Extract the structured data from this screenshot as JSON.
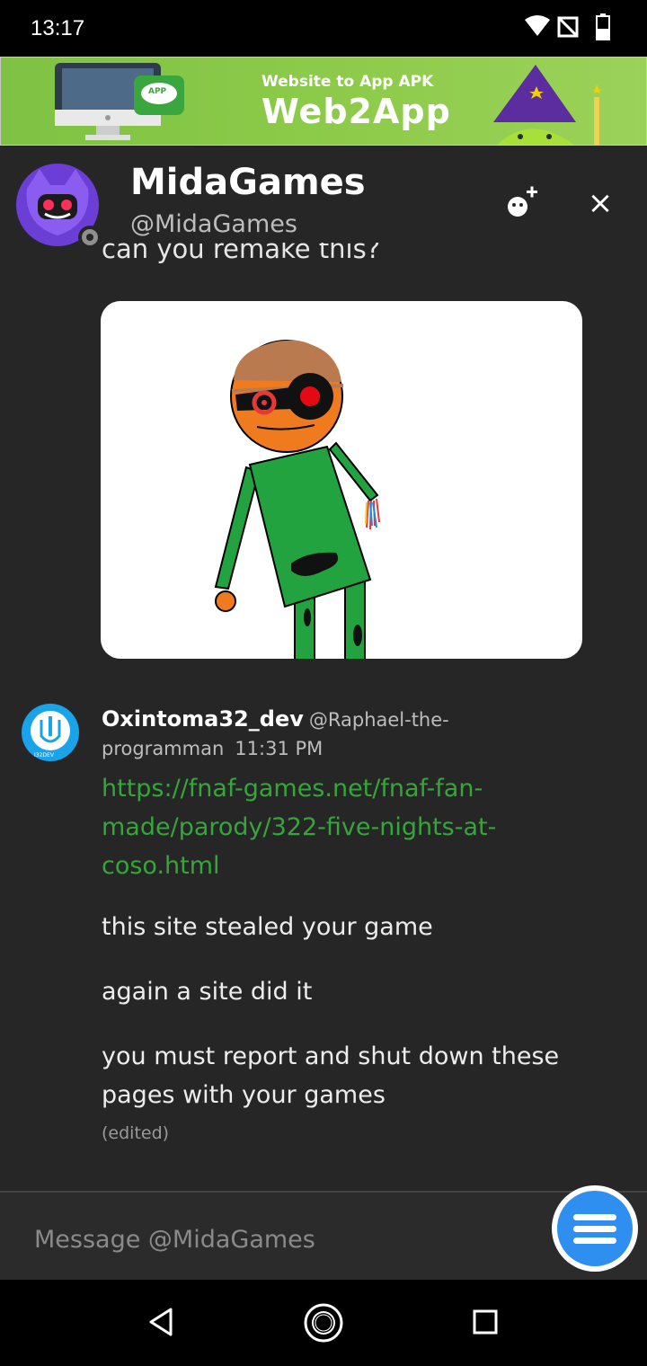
{
  "status_bar": {
    "time": "13:17",
    "icons": [
      "wifi-icon",
      "no-signal-icon",
      "battery-icon"
    ]
  },
  "ad_banner": {
    "tagline": "Website to App APK",
    "brand": "Web2App",
    "app_badge": "APP"
  },
  "header": {
    "name": "MidaGames",
    "handle": "@MidaGames",
    "actions": [
      "add-user-icon",
      "close-icon"
    ]
  },
  "thread": {
    "clipped_previous_text": "can you remake this?",
    "message": {
      "author": "Oxintoma32_dev",
      "author_handle": "@Raphael-the-programman",
      "time": "11:31 PM",
      "avatar_label": "I32DEV",
      "link": "https://fnaf-games.net/fnaf-fan-made/parody/322-five-nights-at-coso.html",
      "paragraphs": [
        "this site stealed your game",
        "again a site did it",
        "you must report and shut down these pages with your games"
      ],
      "edited_label": "(edited)"
    }
  },
  "composer": {
    "placeholder": "Message @MidaGames"
  },
  "colors": {
    "background": "#262626",
    "link": "#35a63a",
    "accent": "#2f8ff0"
  }
}
